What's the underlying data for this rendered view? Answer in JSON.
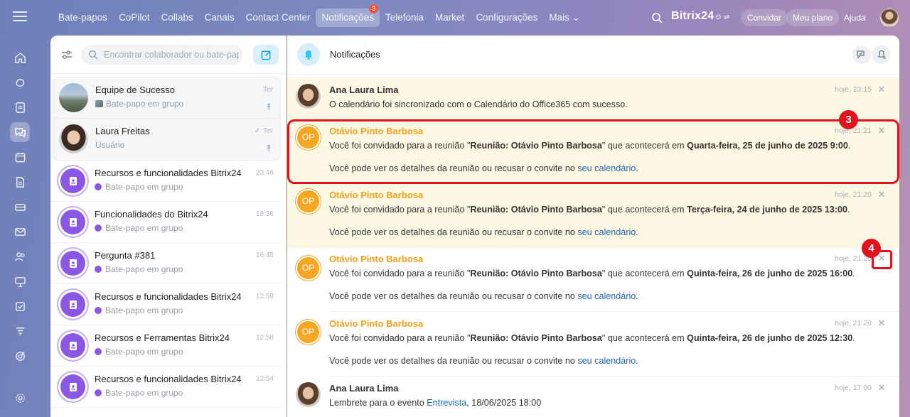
{
  "topbar": {
    "nav": [
      {
        "label": "Bate-papos"
      },
      {
        "label": "CoPilot"
      },
      {
        "label": "Collabs"
      },
      {
        "label": "Canais"
      },
      {
        "label": "Contact Center"
      },
      {
        "label": "Notificações",
        "badge": "3",
        "active": true
      },
      {
        "label": "Telefonia"
      },
      {
        "label": "Market"
      },
      {
        "label": "Configurações"
      },
      {
        "label": "Mais ⌄"
      }
    ],
    "brand": "Bitrix24",
    "brand_mark": "⊙ ⇌",
    "invite": "Convidar",
    "plan": "Meu plano",
    "help": "Ajuda"
  },
  "chat_list": {
    "search_placeholder": "Encontrar colaborador ou bate-papo",
    "pinned": [
      {
        "title": "Equipe de Sucesso",
        "subtitle": "Bate-papo em grupo",
        "time": "Ter"
      },
      {
        "title": "Laura Freitas",
        "subtitle": "Usuário",
        "time": "Ter",
        "read_mark": "✓"
      }
    ],
    "items": [
      {
        "title": "Recursos e funcionalidades Bitrix24",
        "subtitle": "Bate-papo em grupo",
        "time": "23:46"
      },
      {
        "title": "Funcionalidades do Bitrix24",
        "subtitle": "Bate-papo em grupo",
        "time": "18:36"
      },
      {
        "title": "Pergunta #381",
        "subtitle": "Bate-papo em grupo",
        "time": "16:45"
      },
      {
        "title": "Recursos e funcionalidades Bitrix24",
        "subtitle": "Bate-papo em grupo",
        "time": "12:59"
      },
      {
        "title": "Recursos e Ferramentas Bitrix24",
        "subtitle": "Bate-papo em grupo",
        "time": "12:58"
      },
      {
        "title": "Recursos e funcionalidades Bitrix24",
        "subtitle": "Bate-papo em grupo",
        "time": "12:54"
      }
    ]
  },
  "notifications": {
    "title": "Notificações",
    "close_glyph": "✕",
    "items": [
      {
        "author": "Ana Laura Lima",
        "time": "hoje, 23:15",
        "line1": "O calendário foi sincronizado com o Calendário do Office365 com sucesso."
      },
      {
        "author": "Otávio Pinto Barbosa",
        "initials": "OP",
        "time": "hoje, 21:21",
        "line1_a": "Você foi convidado para a reunião \"",
        "line1_b": "Reunião: Otávio Pinto Barbosa",
        "line1_c": "\" que acontecerá em ",
        "line1_d": "Quarta-feira, 25 de junho de 2025 9:00",
        "line1_e": ".",
        "line2_a": "Você pode ver os detalhes da reunião ou recusar o convite no ",
        "line2_link": "seu calendário",
        "line2_b": "."
      },
      {
        "author": "Otávio Pinto Barbosa",
        "initials": "OP",
        "time": "hoje, 21:20",
        "line1_a": "Você foi convidado para a reunião \"",
        "line1_b": "Reunião: Otávio Pinto Barbosa",
        "line1_c": "\" que acontecerá em ",
        "line1_d": "Terça-feira, 24 de junho de 2025 13:00",
        "line1_e": ".",
        "line2_a": "Você pode ver os detalhes da reunião ou recusar o convite no ",
        "line2_link": "seu calendário",
        "line2_b": "."
      },
      {
        "author": "Otávio Pinto Barbosa",
        "initials": "OP",
        "time": "hoje, 21:20",
        "line1_a": "Você foi convidado para a reunião \"",
        "line1_b": "Reunião: Otávio Pinto Barbosa",
        "line1_c": "\" que acontecerá em ",
        "line1_d": "Quinta-feira, 26 de junho de 2025 16:00",
        "line1_e": ".",
        "line2_a": "Você pode ver os detalhes da reunião ou recusar o convite no ",
        "line2_link": "seu calendário",
        "line2_b": "."
      },
      {
        "author": "Otávio Pinto Barbosa",
        "initials": "OP",
        "time": "hoje, 21:20",
        "line1_a": "Você foi convidado para a reunião \"",
        "line1_b": "Reunião: Otávio Pinto Barbosa",
        "line1_c": "\" que acontecerá em ",
        "line1_d": "Quinta-feira, 26 de junho de 2025 12:30",
        "line1_e": ".",
        "line2_a": "Você pode ver os detalhes da reunião ou recusar o convite no ",
        "line2_link": "seu calendário",
        "line2_b": "."
      },
      {
        "author": "Ana Laura Lima",
        "time": "hoje, 17:00",
        "line1_a": "Lembrete para o evento ",
        "line1_link": "Entrevista",
        "line1_b": ", 18/06/2025 18:00"
      }
    ]
  },
  "annotations": {
    "step3": "3",
    "step4": "4"
  },
  "colors": {
    "accent": "#2fc6f6",
    "unread_bg": "#fdf8e4",
    "author_orange": "#f0a11c",
    "highlight_red": "#e1131d",
    "group_purple": "#8a56e4"
  }
}
